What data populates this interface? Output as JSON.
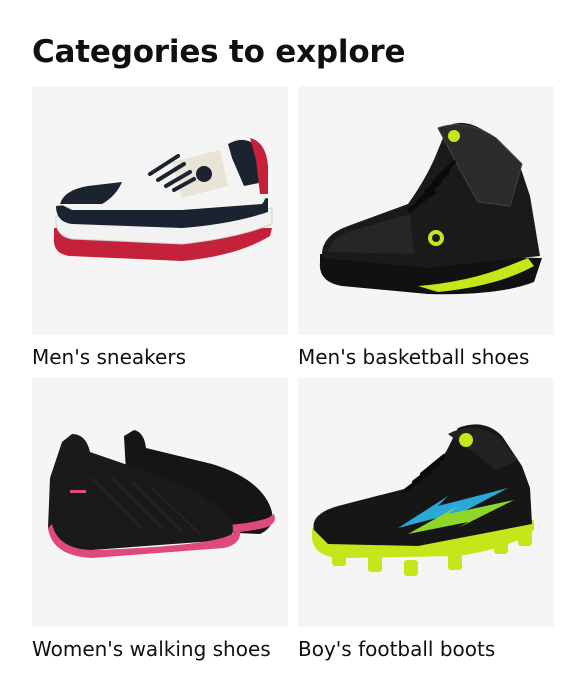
{
  "widget": {
    "title": "Categories to explore",
    "colors": {
      "tile_background": "#f5f5f5",
      "text": "#0f1111"
    },
    "categories": [
      {
        "label": "Men's sneakers",
        "image": "white-black-red-sneaker"
      },
      {
        "label": "Men's basketball shoes",
        "image": "black-neon-basketball-shoe"
      },
      {
        "label": "Women's walking shoes",
        "image": "black-pink-slip-on-pair"
      },
      {
        "label": "Boy's football boots",
        "image": "black-neon-football-boot"
      }
    ]
  }
}
